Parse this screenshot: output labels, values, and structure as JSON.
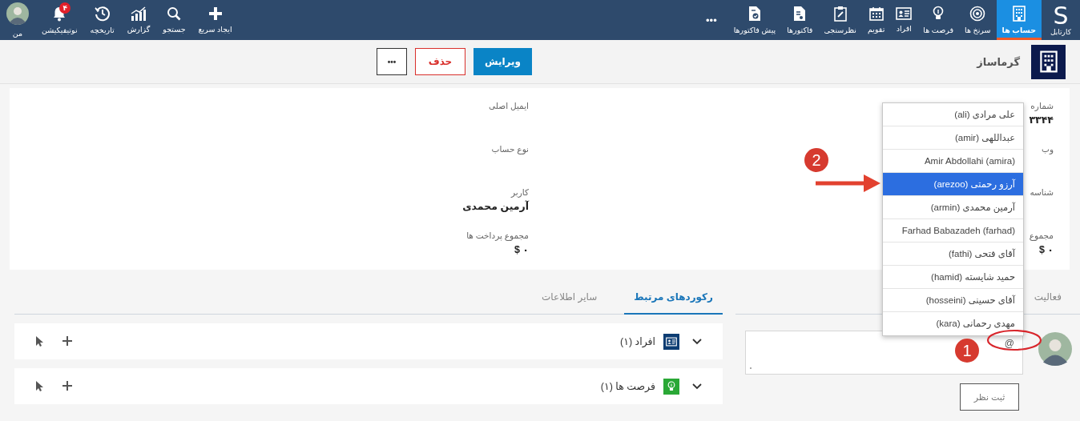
{
  "top_bar": {
    "brand": {
      "logo": "S",
      "label": "کارتابل"
    },
    "modules": [
      {
        "label": "حساب ها",
        "kind": "building",
        "selected": true
      },
      {
        "label": "سرنخ ها",
        "kind": "target",
        "selected": false
      },
      {
        "label": "فرصت ها",
        "kind": "bulb",
        "selected": false
      },
      {
        "label": "افراد",
        "kind": "contact",
        "selected": false
      },
      {
        "label": "تقویم",
        "kind": "calendar",
        "selected": false
      },
      {
        "label": "نظرسنجی",
        "kind": "clipboard",
        "selected": false
      },
      {
        "label": "فاکتورها",
        "kind": "invoice",
        "selected": false
      },
      {
        "label": "پیش فاکتورها",
        "kind": "invoice-check",
        "selected": false
      }
    ],
    "more": "•••",
    "tools": [
      {
        "label": "ایجاد سریع",
        "kind": "plus"
      },
      {
        "label": "جستجو",
        "kind": "search"
      },
      {
        "label": "گزارش",
        "kind": "chart"
      },
      {
        "label": "تاریخچه",
        "kind": "history"
      },
      {
        "label": "نوتیفیکیشن",
        "kind": "bell",
        "badge": "۴"
      },
      {
        "label": "من",
        "kind": "avatar"
      }
    ]
  },
  "record_header": {
    "title": "گرماساز",
    "buttons": [
      {
        "label": "ویرایش",
        "kind": "primary"
      },
      {
        "label": "حذف",
        "kind": "danger"
      },
      {
        "label": "•••",
        "kind": "more"
      }
    ]
  },
  "details": {
    "columns": [
      [
        {
          "label": "شماره",
          "value": "۳۳۴۴"
        },
        {
          "label": "وب"
        },
        {
          "label": "شناسه"
        },
        {
          "label": "مجموع",
          "value": "۰ $"
        }
      ],
      [
        {
          "label": "ایمیل اصلی"
        },
        {
          "label": "نوع حساب"
        },
        {
          "label": "کاربر",
          "value": "آرمین محمدی"
        },
        {
          "label": "مجموع پرداخت ها",
          "value": "۰ $"
        }
      ]
    ]
  },
  "related": {
    "tabs": [
      {
        "label": "رکوردهای مرتبط",
        "selected": true
      },
      {
        "label": "سایر اطلاعات",
        "selected": false
      }
    ],
    "sections": [
      {
        "label": "افراد (۱)",
        "kind": "contact"
      },
      {
        "label": "فرصت ها (۱)",
        "kind": "bulb"
      }
    ]
  },
  "activity": {
    "tabs": [
      {
        "label": "فعالیت",
        "selected": false
      }
    ],
    "comment": {
      "value": "@"
    },
    "submit": "ثبت نظر"
  },
  "mention_menu": {
    "items": [
      {
        "label": "علی مرادی (ali)",
        "selected": false
      },
      {
        "label": "عبداللهی (amir)",
        "selected": false
      },
      {
        "label": "Amir Abdollahi (amira)",
        "selected": false
      },
      {
        "label": "آرزو رحمتی (arezoo)",
        "selected": true
      },
      {
        "label": "آرمین محمدی (armin)",
        "selected": false
      },
      {
        "label": "Farhad Babazadeh (farhad)",
        "selected": false
      },
      {
        "label": "آقای فتحی (fathi)",
        "selected": false
      },
      {
        "label": "حمید شایسته (hamid)",
        "selected": false
      },
      {
        "label": "آقای حسینی (hosseini)",
        "selected": false
      },
      {
        "label": "مهدی رحمانی (kara)",
        "selected": false
      }
    ]
  },
  "annotations": [
    {
      "kind": "ellipse"
    },
    {
      "kind": "step",
      "label": "1"
    },
    {
      "kind": "step",
      "label": "2"
    },
    {
      "kind": "arrow"
    }
  ]
}
